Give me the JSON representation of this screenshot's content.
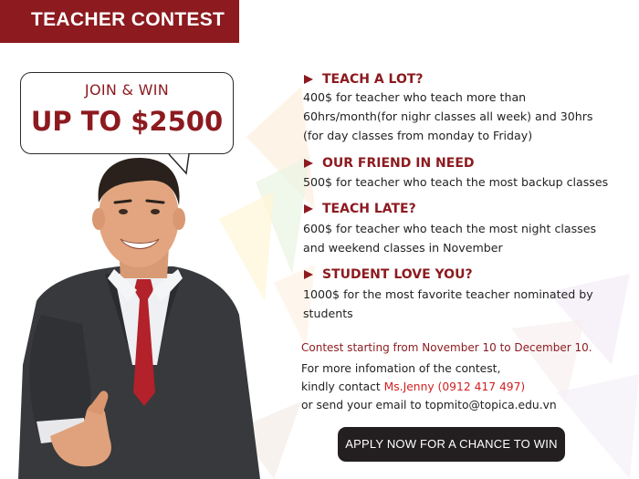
{
  "header": {
    "title": "TEACHER CONTEST"
  },
  "bubble": {
    "line1": "JOIN & WIN",
    "line2": "UP TO $2500"
  },
  "sections": [
    {
      "heading": "TEACH A LOT?",
      "body": [
        "400$ for teacher who teach more than",
        "60hrs/month(for nighr classes all week) and 30hrs",
        "(for day classes from monday to Friday)"
      ]
    },
    {
      "heading": "OUR FRIEND IN NEED",
      "body": [
        "500$ for teacher who teach the most backup classes"
      ]
    },
    {
      "heading": "TEACH LATE?",
      "body": [
        "600$ for teacher who teach the most night classes",
        "and weekend classes in November"
      ]
    },
    {
      "heading": "STUDENT LOVE YOU?",
      "body": [
        "1000$ for the most favorite teacher nominated by",
        "students"
      ]
    }
  ],
  "contest": {
    "dates": "Contest starting from November 10 to December 10.",
    "info_line1": "For more infomation of the contest,",
    "info_prefix": "kindly contact ",
    "contact_name": "Ms.Jenny (0912 417 497)",
    "info_line3": "or send your email to topmito@topica.edu.vn"
  },
  "cta": {
    "label": "APPLY NOW FOR A CHANCE TO WIN"
  },
  "colors": {
    "brand": "#8c1a1f",
    "contact": "#d32020",
    "button": "#231f20"
  },
  "icons": {
    "section_marker": "triangle-right-icon"
  }
}
